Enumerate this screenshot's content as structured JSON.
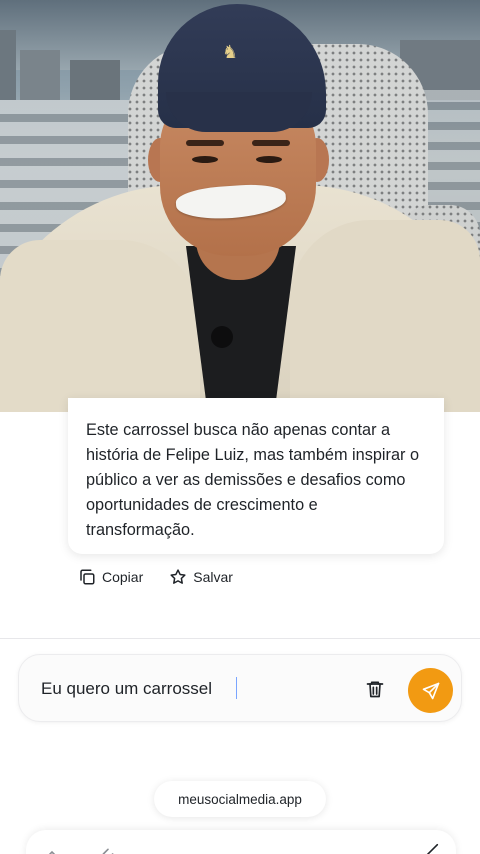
{
  "video": {
    "alt": "man with cap and tape over mouth"
  },
  "message": {
    "text": "Este carrossel busca não apenas contar a história de Felipe Luiz, mas também inspirar o público a ver as demissões e desafios como oportunidades de crescimento e transformação."
  },
  "actions": {
    "copy_label": "Copiar",
    "copy_icon": "copy-icon",
    "save_label": "Salvar",
    "save_icon": "star-icon"
  },
  "composer": {
    "value": "Eu quero um carrossel",
    "trash_icon": "trash-icon",
    "send_icon": "send-icon",
    "send_color": "#f29a12"
  },
  "browser": {
    "url": "meusocialmedia.app"
  }
}
